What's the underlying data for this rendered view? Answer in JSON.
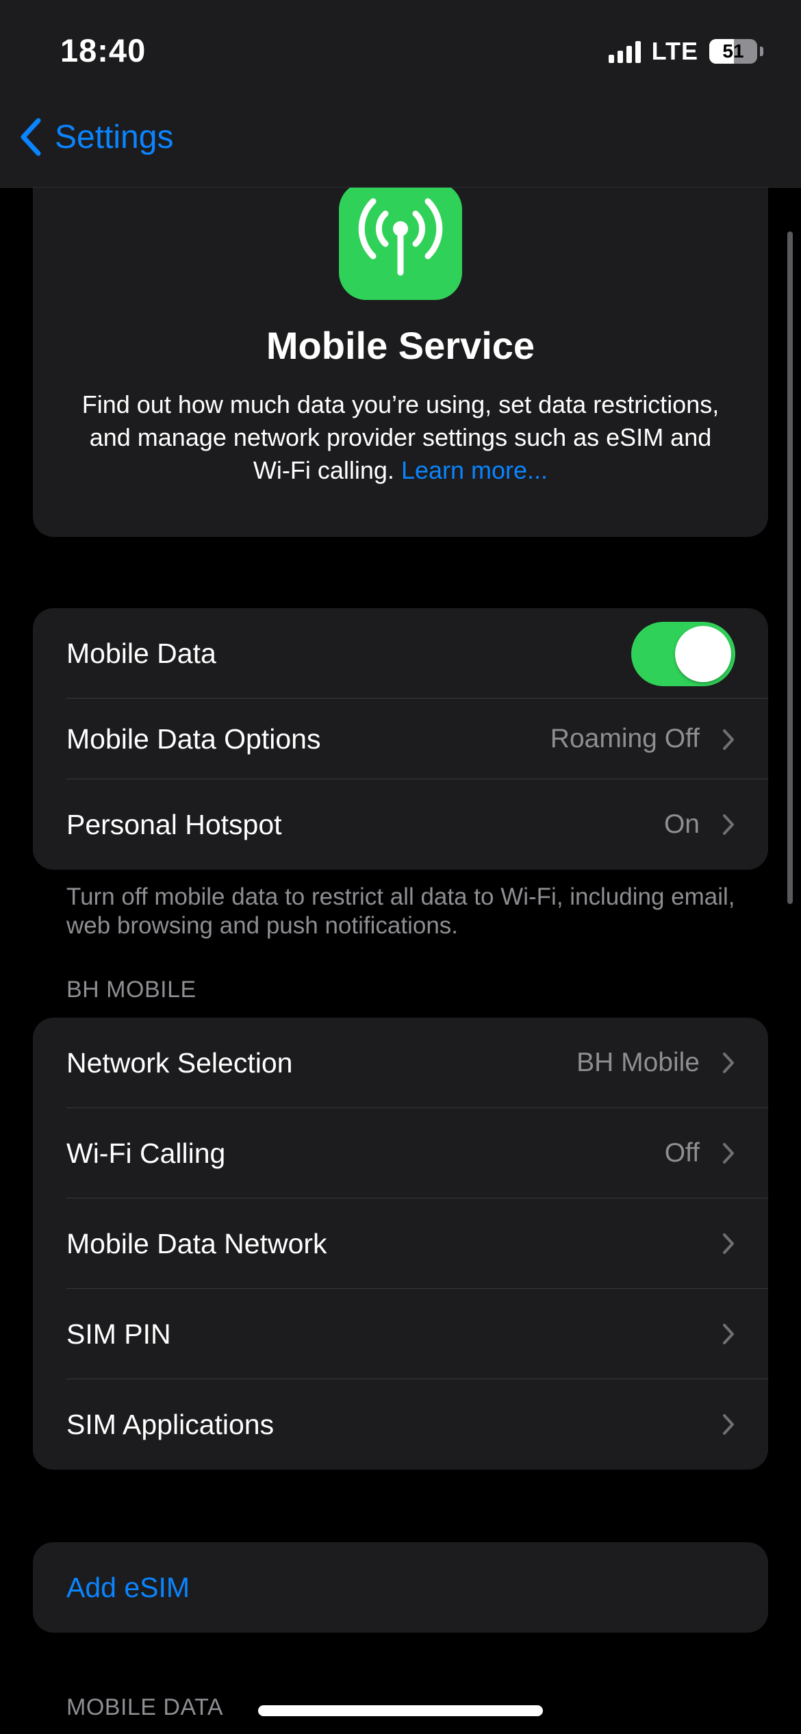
{
  "status_bar": {
    "time": "18:40",
    "network": "LTE",
    "battery": "51",
    "battery_level": 0.51,
    "signal_bars": 4
  },
  "nav": {
    "back_label": "Settings"
  },
  "hero": {
    "icon": "antenna-radiowaves-icon",
    "icon_color": "#30d158",
    "title": "Mobile Service",
    "description": "Find out how much data you’re using, set data restrictions, and manage network provider settings such as eSIM and Wi-Fi calling.",
    "link": "Learn more..."
  },
  "data_group": {
    "mobile_data": {
      "label": "Mobile Data",
      "enabled": true
    },
    "mobile_data_options": {
      "label": "Mobile Data Options",
      "value": "Roaming Off"
    },
    "personal_hotspot": {
      "label": "Personal Hotspot",
      "value": "On"
    },
    "footer": "Turn off mobile data to restrict all data to Wi-Fi, including email, web browsing and push notifications."
  },
  "carrier_section": {
    "header": "BH MOBILE",
    "items": [
      {
        "label": "Network Selection",
        "value": "BH Mobile"
      },
      {
        "label": "Wi-Fi Calling",
        "value": "Off"
      },
      {
        "label": "Mobile Data Network",
        "value": ""
      },
      {
        "label": "SIM PIN",
        "value": ""
      },
      {
        "label": "SIM Applications",
        "value": ""
      }
    ]
  },
  "esim": {
    "add_label": "Add eSIM"
  },
  "next_section_header": "MOBILE DATA",
  "colors": {
    "accent": "#0a84ff",
    "toggle_on": "#30d158",
    "card_bg": "#1c1c1e",
    "secondary_text": "#8e8e93"
  }
}
